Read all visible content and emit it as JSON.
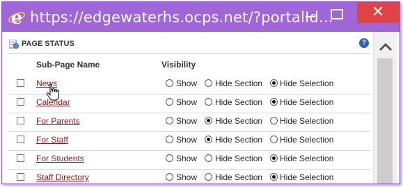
{
  "window": {
    "url": "https://edgewaterhs.ocps.net/?portalId...",
    "close_glyph": "✕"
  },
  "panel": {
    "title": "PAGE STATUS",
    "help_glyph": "?"
  },
  "columns": {
    "name": "Sub-Page Name",
    "visibility": "Visibility"
  },
  "radio_labels": {
    "show": "Show",
    "hide_section": "Hide Section",
    "hide_selection": "Hide Selection"
  },
  "rows": [
    {
      "name": "News",
      "selected": "hide_selection"
    },
    {
      "name": "Calendar",
      "selected": "hide_selection"
    },
    {
      "name": "For Parents",
      "selected": "hide_section"
    },
    {
      "name": "For Staff",
      "selected": "hide_section"
    },
    {
      "name": "For Students",
      "selected": "hide_selection"
    },
    {
      "name": "Staff Directory",
      "selected": "hide_selection"
    }
  ],
  "colors": {
    "titlebar": "#a066d8",
    "close": "#e04343",
    "link": "#8b1a1a"
  },
  "icons": {
    "browser": "internet-explorer-icon",
    "cursor": "hand-pointer-icon",
    "scroll": "chevron-up-icon"
  }
}
